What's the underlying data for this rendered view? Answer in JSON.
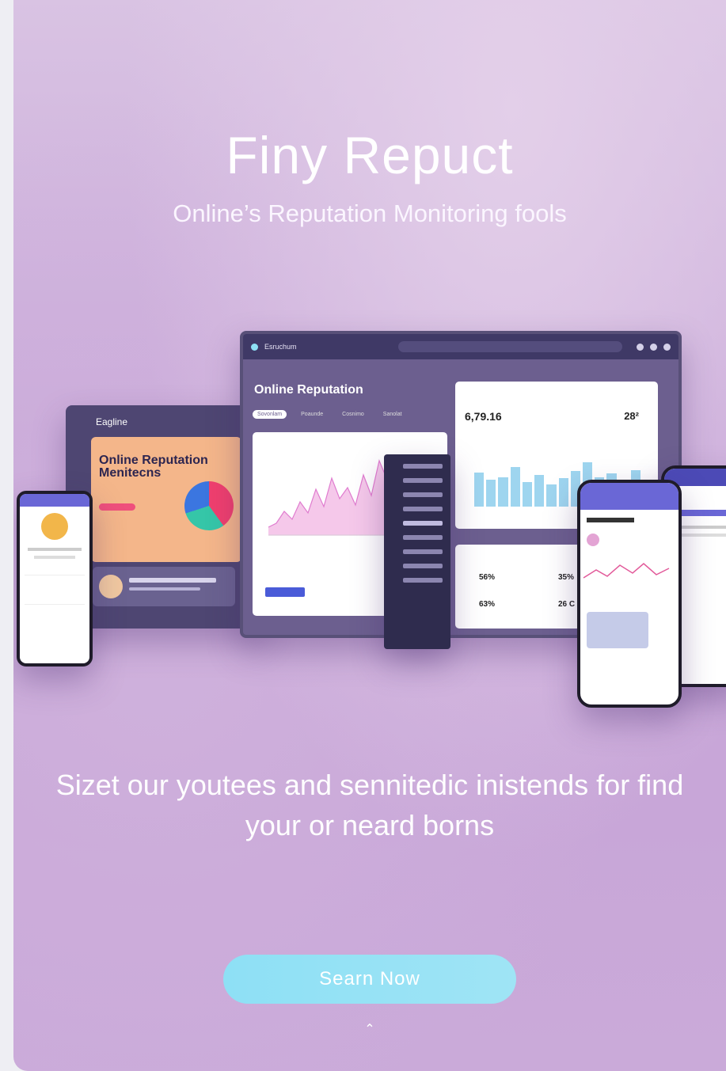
{
  "hero": {
    "title": "Finy Repuct",
    "subtitle": "Online’s Reputation Monitoring fools",
    "tagline": "Sizet our youtees and sennitedic inistends for find your or neard borns",
    "cta_label": "Searn Now",
    "scroll_icon": "chevron-up-icon"
  },
  "mockup": {
    "dashboard_title": "Online Reputation",
    "stat_value": "6,79.16",
    "stat_pct": "28²",
    "mentions": [
      "56% ",
      "35%",
      "63%",
      "26 C"
    ],
    "promo_title": "Online Reputation Menitecns",
    "brand": "Eagline"
  },
  "colors": {
    "accent": "#8ee0f5",
    "bg": "#c9a9d9",
    "panel": "#6c5f8f"
  }
}
